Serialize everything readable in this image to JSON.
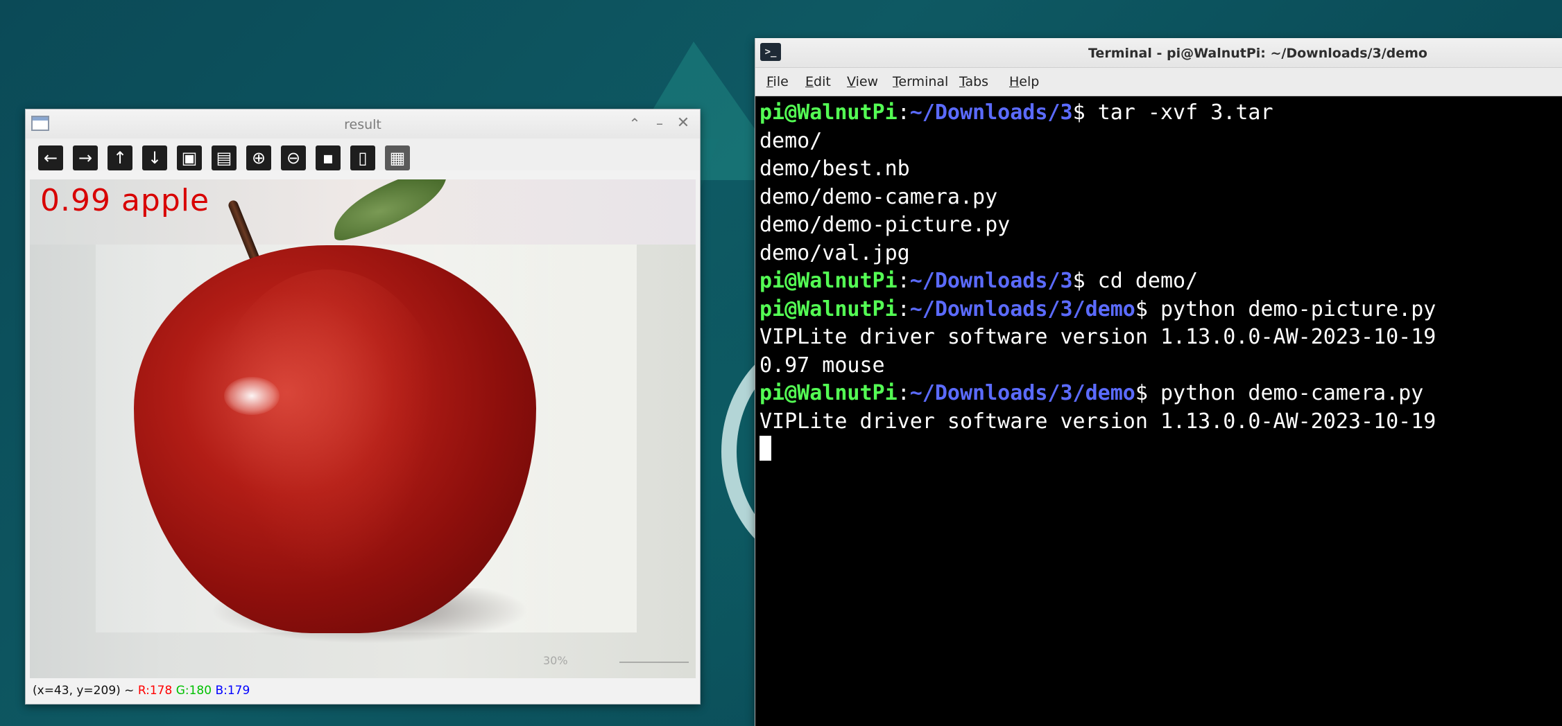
{
  "result_window": {
    "title": "result",
    "toolbar": [
      {
        "name": "pan-left-button",
        "icon": "arrow-left-icon",
        "glyph": "←"
      },
      {
        "name": "pan-right-button",
        "icon": "arrow-right-icon",
        "glyph": "→"
      },
      {
        "name": "pan-up-button",
        "icon": "arrow-up-icon",
        "glyph": "↑"
      },
      {
        "name": "pan-down-button",
        "icon": "arrow-down-icon",
        "glyph": "↓"
      },
      {
        "name": "zoom-fit-button",
        "icon": "image-icon",
        "glyph": "▣"
      },
      {
        "name": "zoom-original-button",
        "icon": "image-zoom-icon",
        "glyph": "▤"
      },
      {
        "name": "zoom-in-button",
        "icon": "zoom-in-icon",
        "glyph": "⊕"
      },
      {
        "name": "zoom-out-button",
        "icon": "zoom-out-icon",
        "glyph": "⊖"
      },
      {
        "name": "save-button",
        "icon": "save-icon",
        "glyph": "▪"
      },
      {
        "name": "copy-clipboard-button",
        "icon": "clipboard-icon",
        "glyph": "▯"
      },
      {
        "name": "properties-button",
        "icon": "properties-icon",
        "glyph": "▦"
      }
    ],
    "detection_label": "0.99 apple",
    "status": {
      "coords": "(x=43, y=209) ~",
      "r": "R:178",
      "g": "G:180",
      "b": "B:179"
    },
    "image_overlay": {
      "zoom": "30%"
    }
  },
  "terminal_window": {
    "title": "Terminal - pi@WalnutPi: ~/Downloads/3/demo",
    "icon_glyph": ">_",
    "menu": [
      "File",
      "Edit",
      "View",
      "Terminal",
      "Tabs",
      "Help"
    ],
    "lines": [
      {
        "type": "prompt",
        "user": "pi@WalnutPi",
        "sep": ":",
        "path": "~/Downloads/3",
        "cmd": "$ tar -xvf 3.tar"
      },
      {
        "type": "output",
        "text": "demo/"
      },
      {
        "type": "output",
        "text": "demo/best.nb"
      },
      {
        "type": "output",
        "text": "demo/demo-camera.py"
      },
      {
        "type": "output",
        "text": "demo/demo-picture.py"
      },
      {
        "type": "output",
        "text": "demo/val.jpg"
      },
      {
        "type": "prompt",
        "user": "pi@WalnutPi",
        "sep": ":",
        "path": "~/Downloads/3",
        "cmd": "$ cd demo/"
      },
      {
        "type": "prompt",
        "user": "pi@WalnutPi",
        "sep": ":",
        "path": "~/Downloads/3/demo",
        "cmd": "$ python demo-picture.py"
      },
      {
        "type": "output",
        "text": "VIPLite driver software version 1.13.0.0-AW-2023-10-19"
      },
      {
        "type": "output",
        "text": "0.97 mouse"
      },
      {
        "type": "prompt",
        "user": "pi@WalnutPi",
        "sep": ":",
        "path": "~/Downloads/3/demo",
        "cmd": "$ python demo-camera.py"
      },
      {
        "type": "output",
        "text": "VIPLite driver software version 1.13.0.0-AW-2023-10-19"
      }
    ]
  }
}
